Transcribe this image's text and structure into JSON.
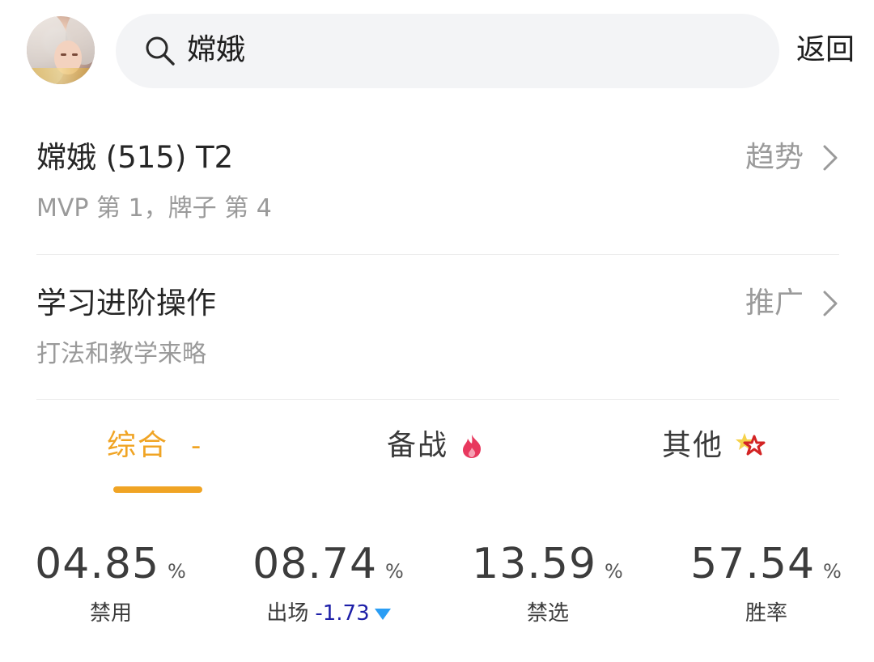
{
  "header": {
    "search_text": "嫦娥",
    "back_label": "返回"
  },
  "hero_row": {
    "title": "嫦娥 (515) T2",
    "subtitle": "MVP 第 1，牌子 第 4",
    "action_label": "趋势"
  },
  "learn_row": {
    "title": "学习进阶操作",
    "subtitle": "打法和教学来略",
    "action_label": "推广"
  },
  "tabs": [
    {
      "label": "综合",
      "suffix": "-",
      "active": true,
      "icon": "none"
    },
    {
      "label": "备战",
      "suffix": "",
      "active": false,
      "icon": "flame-icon"
    },
    {
      "label": "其他",
      "suffix": "",
      "active": false,
      "icon": "star-icon"
    }
  ],
  "stats": [
    {
      "value": "04.85",
      "unit": "%",
      "label": "禁用"
    },
    {
      "value": "08.74",
      "unit": "%",
      "label": "出场",
      "delta": "-1.73",
      "trend": "down"
    },
    {
      "value": "13.59",
      "unit": "%",
      "label": "禁选"
    },
    {
      "value": "57.54",
      "unit": "%",
      "label": "胜率"
    }
  ],
  "colors": {
    "accent": "#f0a424",
    "delta_text": "#1d1fa8",
    "trend_down": "#2a9df4",
    "flame": "#e8385e"
  }
}
